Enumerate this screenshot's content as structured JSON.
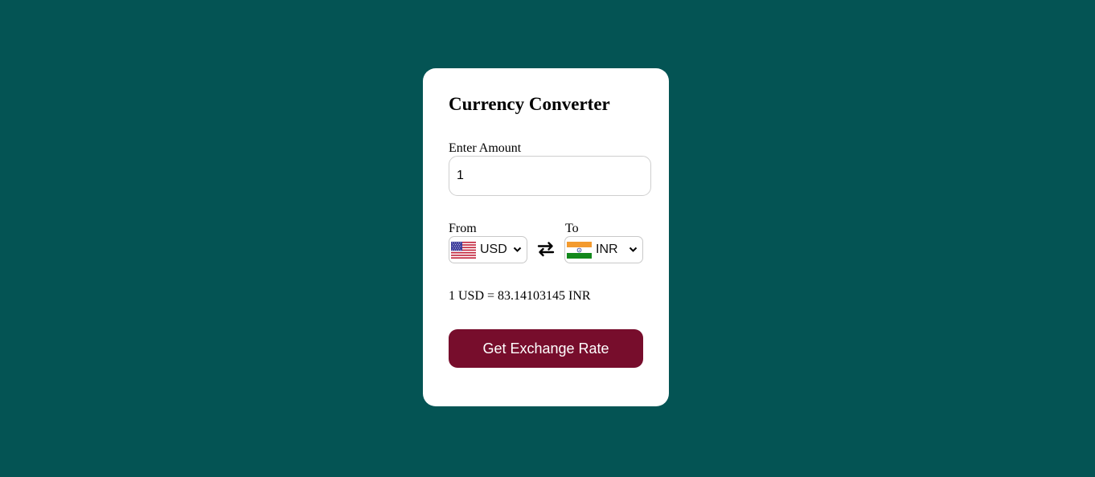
{
  "app": {
    "title": "Currency Converter"
  },
  "amount": {
    "label": "Enter Amount",
    "value": "1"
  },
  "from": {
    "label": "From",
    "currency": "USD",
    "flag_icon": "us-flag-icon"
  },
  "to": {
    "label": "To",
    "currency": "INR",
    "flag_icon": "india-flag-icon"
  },
  "swap_icon": "swap-arrows-icon",
  "result": {
    "text": "1 USD = 83.14103145 INR"
  },
  "button": {
    "label": "Get Exchange Rate"
  },
  "colors": {
    "background": "#045454",
    "card": "#ffffff",
    "button": "#770d2c",
    "button_text": "#ffffff"
  }
}
